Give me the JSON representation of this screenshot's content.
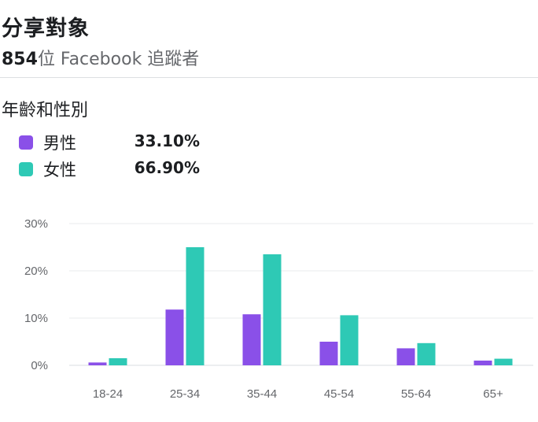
{
  "header": {
    "title": "分享對象",
    "follower_count": "854",
    "follower_text": "位 Facebook 追蹤者"
  },
  "section": {
    "title": "年齡和性別"
  },
  "legend": [
    {
      "label": "男性",
      "value": "33.10%",
      "color": "#8a50e8"
    },
    {
      "label": "女性",
      "value": "66.90%",
      "color": "#2ec9b5"
    }
  ],
  "chart_data": {
    "type": "bar",
    "categories": [
      "18-24",
      "25-34",
      "35-44",
      "45-54",
      "55-64",
      "65+"
    ],
    "series": [
      {
        "name": "男性",
        "color": "#8a50e8",
        "values": [
          0.6,
          11.8,
          10.8,
          5.0,
          3.6,
          1.0
        ]
      },
      {
        "name": "女性",
        "color": "#2ec9b5",
        "values": [
          1.5,
          25.0,
          23.5,
          10.6,
          4.7,
          1.4
        ]
      }
    ],
    "yticks": [
      "0%",
      "10%",
      "20%",
      "30%"
    ],
    "ylim": [
      0,
      30
    ],
    "grid": true,
    "legend": "top-left"
  }
}
